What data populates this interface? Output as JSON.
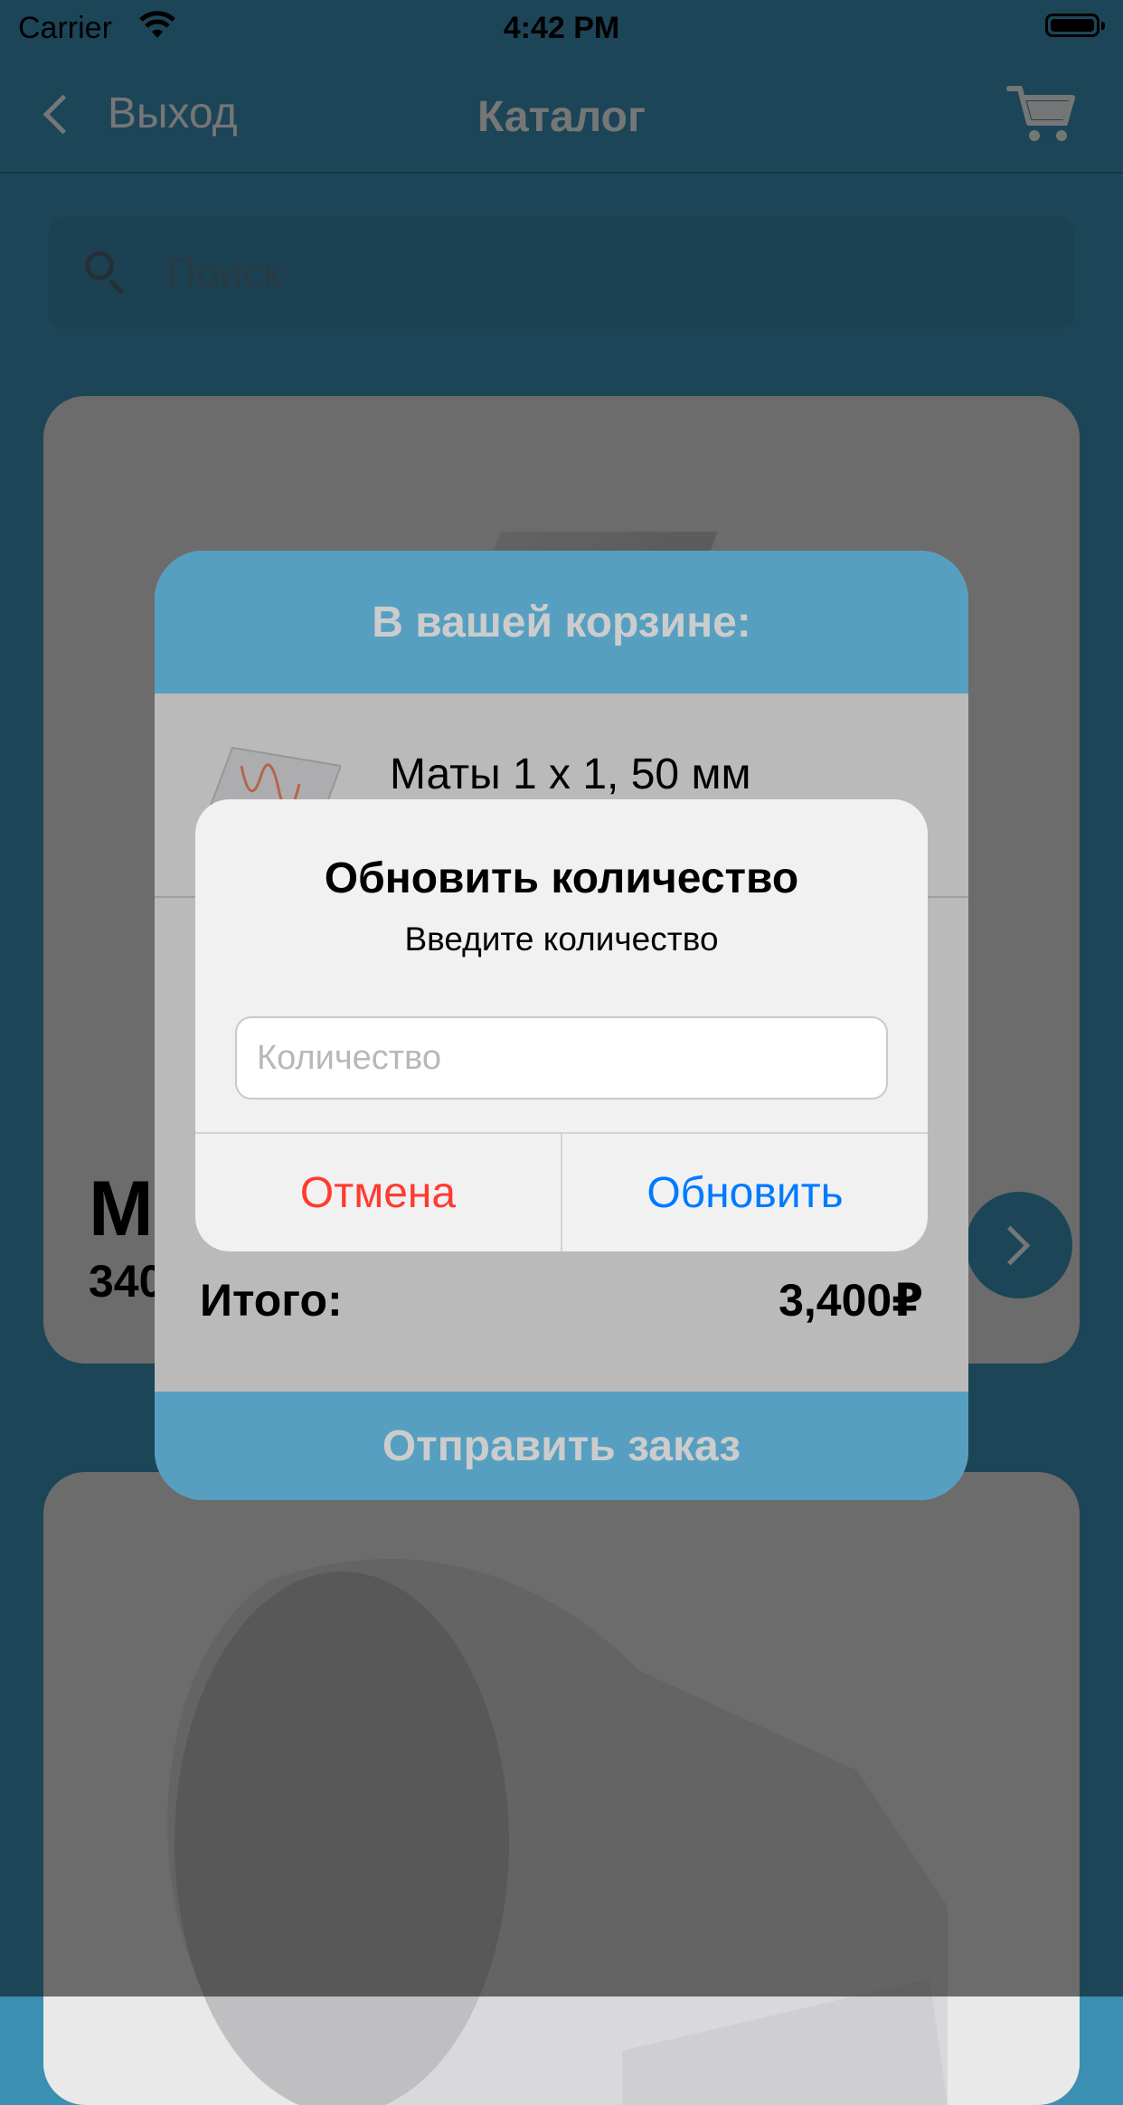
{
  "statusbar": {
    "carrier": "Carrier",
    "time": "4:42 PM"
  },
  "navbar": {
    "back_label": "Выход",
    "title": "Каталог"
  },
  "search": {
    "placeholder": "Поиск"
  },
  "product_card": {
    "title": "М",
    "price": "340"
  },
  "cart_popup": {
    "title": "В вашей корзине:",
    "items": [
      {
        "name": "Маты 1 х 1, 50 мм"
      }
    ],
    "total_label": "Итого:",
    "total_value": "3,400₽",
    "submit_label": "Отправить заказ"
  },
  "alert": {
    "title": "Обновить количество",
    "message": "Введите количество",
    "input_placeholder": "Количество",
    "input_value": "",
    "cancel_label": "Отмена",
    "update_label": "Обновить"
  },
  "colors": {
    "accent": "#3f97bf",
    "popup_header": "#6cc7f2",
    "cancel": "#ff3b30",
    "update": "#007aff"
  }
}
